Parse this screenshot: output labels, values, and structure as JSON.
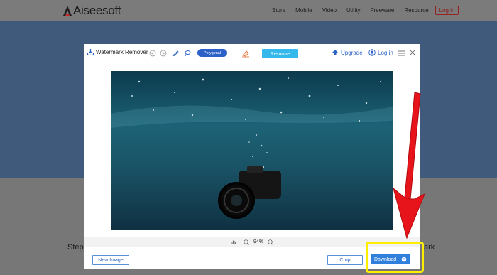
{
  "site": {
    "brand": "Aiseesoft",
    "nav": [
      "Store",
      "Mobile",
      "Video",
      "Utility",
      "Freeware",
      "Resource"
    ],
    "login": "Log in",
    "step_text": "Step",
    "right_text": "ark"
  },
  "tool": {
    "title": "Watermark Remover",
    "polygonal_label": "Polygonal",
    "remove_label": "Remove",
    "upgrade_label": "Upgrade",
    "login_label": "Log in",
    "zoom": "94%",
    "new_image_label": "New Image",
    "crop_label": "Crop",
    "download_label": "Download"
  },
  "colors": {
    "accent_blue": "#2f7fdc",
    "remove_blue": "#35b8ec",
    "highlight_yellow": "#ffee00",
    "arrow_red": "#e8141b"
  }
}
